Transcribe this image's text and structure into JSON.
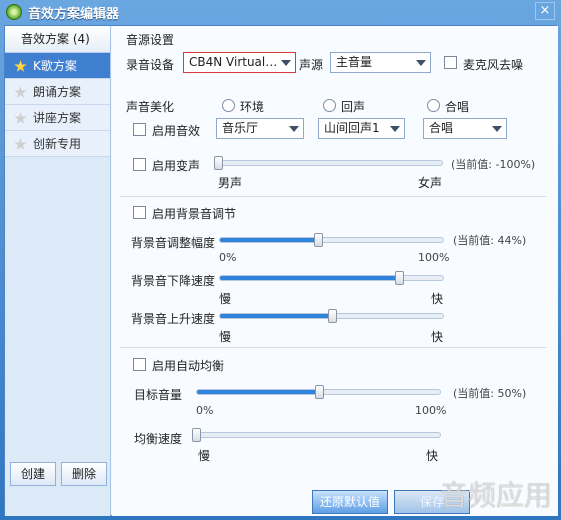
{
  "app": {
    "title": "音效方案编辑器",
    "close": "×"
  },
  "sidebar": {
    "header": "音效方案 (4)",
    "items": [
      {
        "label": "K歌方案",
        "icon": "star-icon"
      },
      {
        "label": "朗诵方案",
        "icon": "star-icon"
      },
      {
        "label": "讲座方案",
        "icon": "star-icon"
      },
      {
        "label": "创新专用",
        "icon": "star-icon"
      }
    ],
    "buttons": {
      "create": "创建",
      "delete": "删除"
    }
  },
  "source": {
    "section": "音源设置",
    "record_label": "录音设备",
    "record_value": "CB4N Virtual…",
    "source_label": "声源",
    "source_value": "主音量",
    "noise_label": "麦克风去噪"
  },
  "beauty": {
    "section": "声音美化",
    "radio_env": "环境",
    "radio_echo": "回声",
    "radio_chorus": "合唱",
    "enable_effect": "启用音效",
    "env_value": "音乐厅",
    "echo_value": "山间回声1",
    "chorus_value": "合唱",
    "enable_voice": "启用变声",
    "voice_current": "(当前值: -100%)",
    "voice_value": -100,
    "male": "男声",
    "female": "女声"
  },
  "background": {
    "enable": "启用背景音调节",
    "adjust_label": "背景音调整幅度",
    "adjust_current": "(当前值: 44%)",
    "adjust_value": 44,
    "min": "0%",
    "max": "100%",
    "down_label": "背景音下降速度",
    "down_value": 80,
    "slow": "慢",
    "fast": "快",
    "up_label": "背景音上升速度",
    "up_value": 50
  },
  "balance": {
    "enable": "启用自动均衡",
    "target_label": "目标音量",
    "target_current": "(当前值: 50%)",
    "target_value": 50,
    "speed_label": "均衡速度",
    "speed_value": 0
  },
  "footer": {
    "reset": "还原默认值",
    "save": "保存",
    "watermark": "音频应用"
  },
  "colors": {
    "accent": "#2f83da",
    "border": "#4d84c7"
  }
}
